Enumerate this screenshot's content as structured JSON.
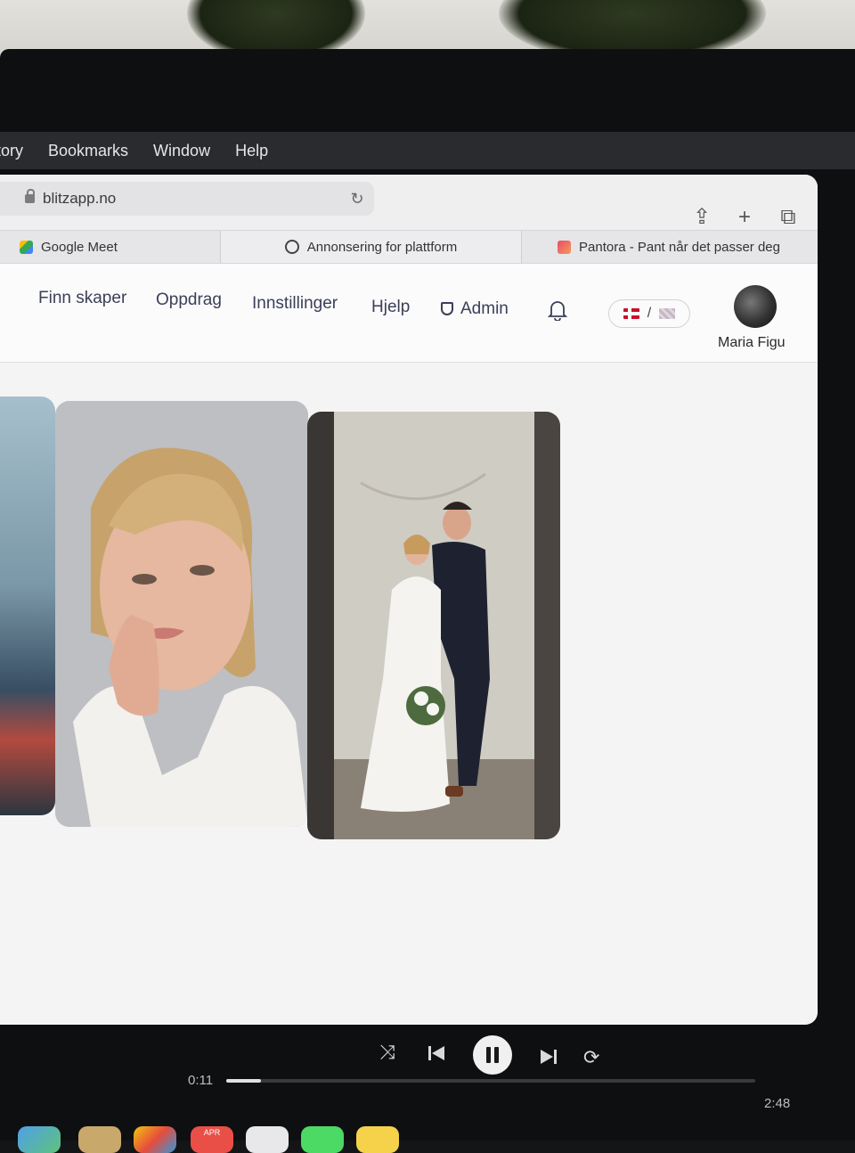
{
  "menubar": {
    "items": [
      "tory",
      "Bookmarks",
      "Window",
      "Help"
    ]
  },
  "browser": {
    "url": "blitzapp.no",
    "tabs": [
      {
        "label": "Google Meet",
        "icon": "google-meet-icon"
      },
      {
        "label": "Annonsering for plattform",
        "icon": "chatgpt-icon"
      },
      {
        "label": "Pantora - Pant når det passer deg",
        "icon": "pantora-icon"
      }
    ]
  },
  "nav": {
    "items": [
      "Finn skaper",
      "Oppdrag",
      "Innstillinger",
      "Hjelp",
      "Admin"
    ],
    "lang_separator": "/",
    "user_name": "Maria Figu"
  },
  "gallery": {
    "cards": [
      "portrait-partial",
      "woman-portrait",
      "wedding-couple"
    ]
  },
  "player": {
    "elapsed": "0:11",
    "duration": "2:48",
    "progress": 0.065
  },
  "dock": {
    "calendar_month": "APR"
  },
  "colors": {
    "nav_text": "#3b3f58",
    "page_bg": "#f4f4f5",
    "bezel": "#0e0f11"
  }
}
